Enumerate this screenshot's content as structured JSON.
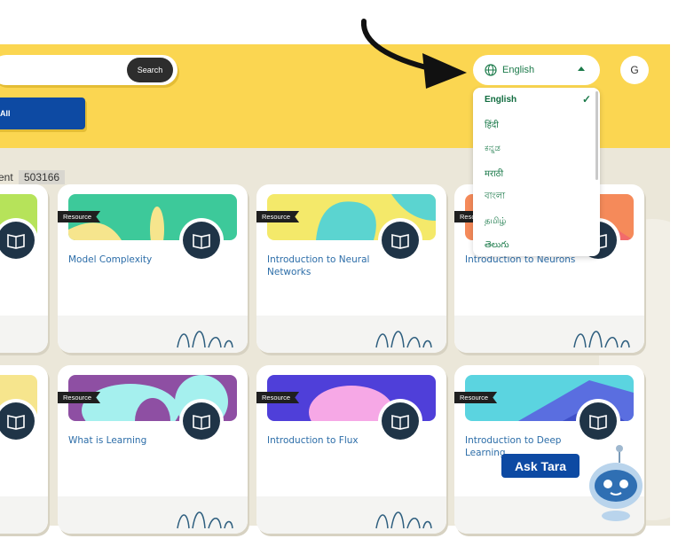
{
  "header": {
    "search_button": "Search",
    "all_button": "All",
    "avatar_initial": "G"
  },
  "language": {
    "current": "English",
    "options": [
      "English",
      "हिंदी",
      "ಕನ್ನಡ",
      "मराठी",
      "বাংলা",
      "தமிழ்",
      "తెలుగు"
    ],
    "selected_index": 0
  },
  "results": {
    "label": "ent",
    "count": "503166"
  },
  "cards": [
    {
      "title": "Model Complexity",
      "tag": "Resource"
    },
    {
      "title": "Introduction to Neural Networks",
      "tag": "Resource"
    },
    {
      "title": "Introduction to Neurons",
      "tag": "Resource"
    },
    {
      "title": "What is Learning",
      "tag": "Resource"
    },
    {
      "title": "Introduction to Flux",
      "tag": "Resource"
    },
    {
      "title": "Introduction to Deep Learning",
      "tag": "Resource"
    }
  ],
  "assistant": {
    "label": "Ask Tara"
  },
  "colors": {
    "header_bg": "#fbd651",
    "primary_blue": "#0d4aa3",
    "link_green": "#1b7a4a",
    "card_title": "#2c6da8"
  }
}
